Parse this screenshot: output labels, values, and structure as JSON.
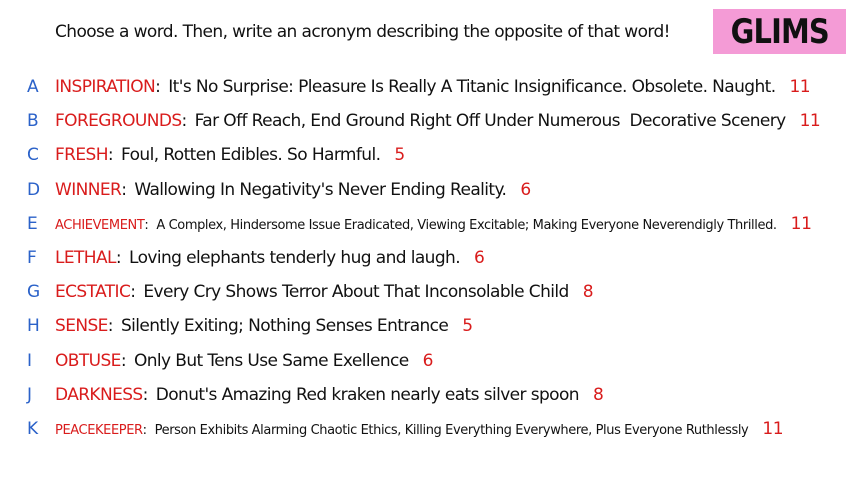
{
  "prompt": "Choose a word. Then, write an acronym describing the opposite of that word!",
  "logo": "GLIMS",
  "colors": {
    "letter": "#2b62c9",
    "word": "#d91c1c",
    "text": "#111111",
    "logo_bg": "#f49bd6"
  },
  "rows": [
    {
      "letter": "A",
      "word": "INSPIRATION",
      "acronym": "It's No Surprise: Pleasure Is Really A Titanic Insignificance. Obsolete. Naught.",
      "count": "11"
    },
    {
      "letter": "B",
      "word": "FOREGROUNDS",
      "acronym": "Far Off Reach, End Ground Right Off Under Numerous  Decorative Scenery",
      "count": "11"
    },
    {
      "letter": "C",
      "word": "FRESH",
      "acronym": "Foul, Rotten Edibles. So Harmful.",
      "count": "5"
    },
    {
      "letter": "D",
      "word": "WINNER",
      "acronym": "Wallowing In Negativity's Never Ending Reality.",
      "count": "6"
    },
    {
      "letter": "E",
      "word": "ACHIEVEMENT",
      "acronym": "A Complex, Hindersome Issue Eradicated, Viewing Excitable; Making Everyone Neverendigly Thrilled.",
      "count": "11"
    },
    {
      "letter": "F",
      "word": "LETHAL",
      "acronym": "Loving elephants tenderly hug and laugh.",
      "count": "6"
    },
    {
      "letter": "G",
      "word": "ECSTATIC",
      "acronym": "Every Cry Shows Terror About That Inconsolable Child",
      "count": "8"
    },
    {
      "letter": "H",
      "word": "SENSE",
      "acronym": "Silently Exiting; Nothing Senses Entrance",
      "count": "5"
    },
    {
      "letter": "I",
      "word": "OBTUSE",
      "acronym": "Only But Tens Use Same Exellence",
      "count": "6"
    },
    {
      "letter": "J",
      "word": "DARKNESS",
      "acronym": "Donut's Amazing Red kraken nearly eats silver spoon",
      "count": "8"
    },
    {
      "letter": "K",
      "word": "PEACEKEEPER",
      "acronym": "Person Exhibits Alarming Chaotic Ethics, Killing Everything Everywhere, Plus Everyone Ruthlessly",
      "count": "11"
    }
  ]
}
